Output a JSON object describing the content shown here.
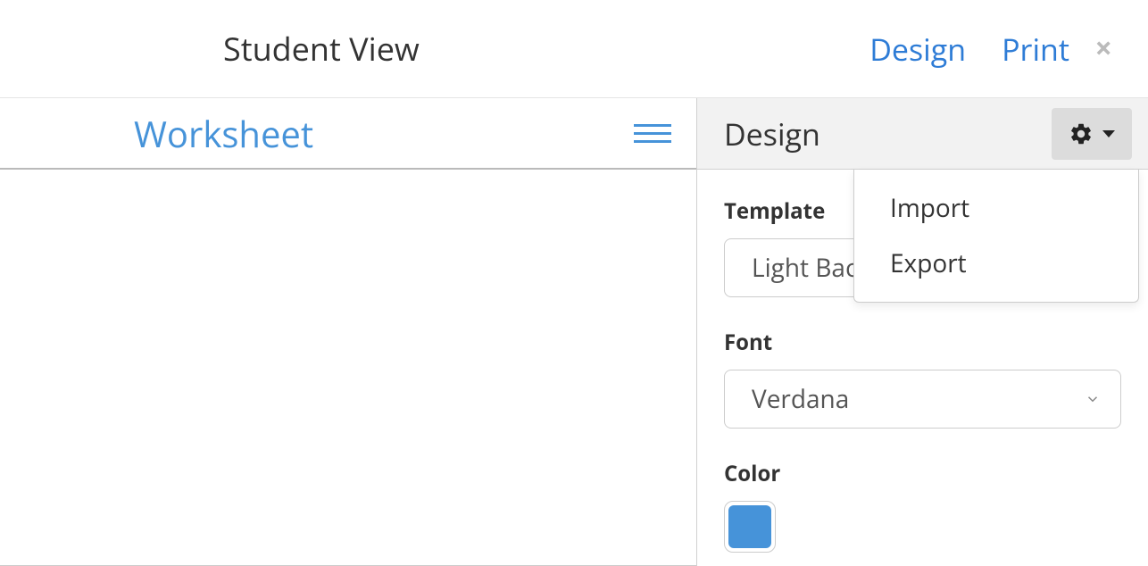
{
  "header": {
    "title": "Student View",
    "links": {
      "design": "Design",
      "print": "Print"
    }
  },
  "leftPanel": {
    "worksheetTitle": "Worksheet"
  },
  "designPanel": {
    "title": "Design",
    "template": {
      "label": "Template",
      "value": "Light Background"
    },
    "font": {
      "label": "Font",
      "value": "Verdana"
    },
    "color": {
      "label": "Color",
      "value": "#4693d9"
    },
    "gearMenu": {
      "items": [
        "Import",
        "Export"
      ]
    }
  }
}
